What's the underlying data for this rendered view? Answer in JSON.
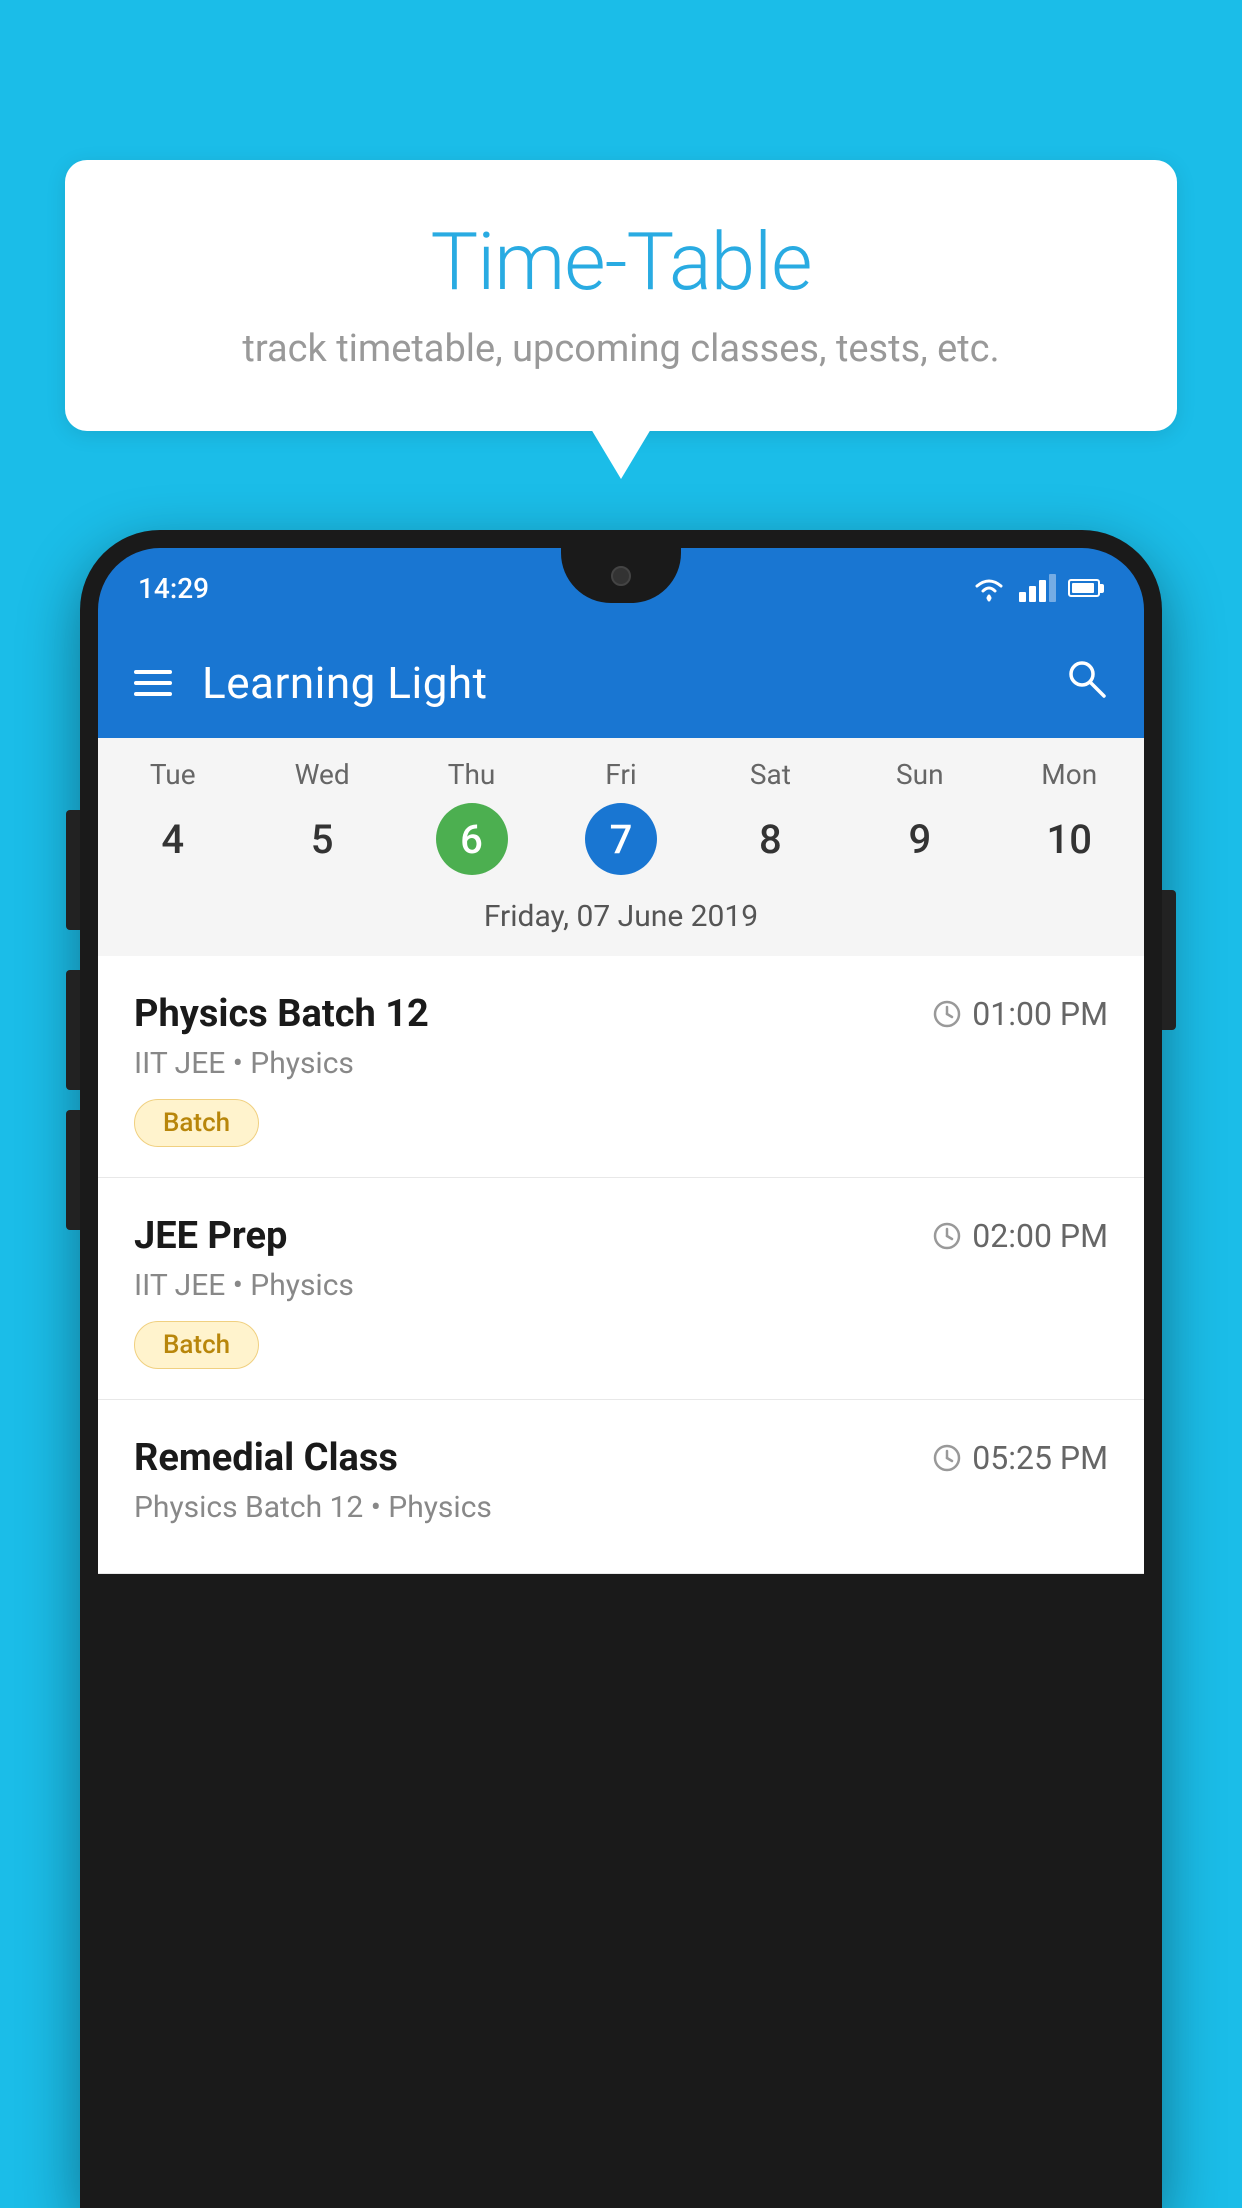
{
  "background_color": "#1BBDE8",
  "speech_bubble": {
    "title": "Time-Table",
    "subtitle": "track timetable, upcoming classes, tests, etc."
  },
  "phone": {
    "status_bar": {
      "time": "14:29"
    },
    "app_bar": {
      "title": "Learning Light"
    },
    "calendar": {
      "days": [
        {
          "name": "Tue",
          "num": "4",
          "state": "normal"
        },
        {
          "name": "Wed",
          "num": "5",
          "state": "normal"
        },
        {
          "name": "Thu",
          "num": "6",
          "state": "today"
        },
        {
          "name": "Fri",
          "num": "7",
          "state": "selected"
        },
        {
          "name": "Sat",
          "num": "8",
          "state": "normal"
        },
        {
          "name": "Sun",
          "num": "9",
          "state": "normal"
        },
        {
          "name": "Mon",
          "num": "10",
          "state": "normal"
        }
      ],
      "selected_date_label": "Friday, 07 June 2019"
    },
    "schedule": [
      {
        "title": "Physics Batch 12",
        "time": "01:00 PM",
        "meta": "IIT JEE • Physics",
        "badge": "Batch"
      },
      {
        "title": "JEE Prep",
        "time": "02:00 PM",
        "meta": "IIT JEE • Physics",
        "badge": "Batch"
      },
      {
        "title": "Remedial Class",
        "time": "05:25 PM",
        "meta": "Physics Batch 12 • Physics",
        "badge": null
      }
    ]
  }
}
